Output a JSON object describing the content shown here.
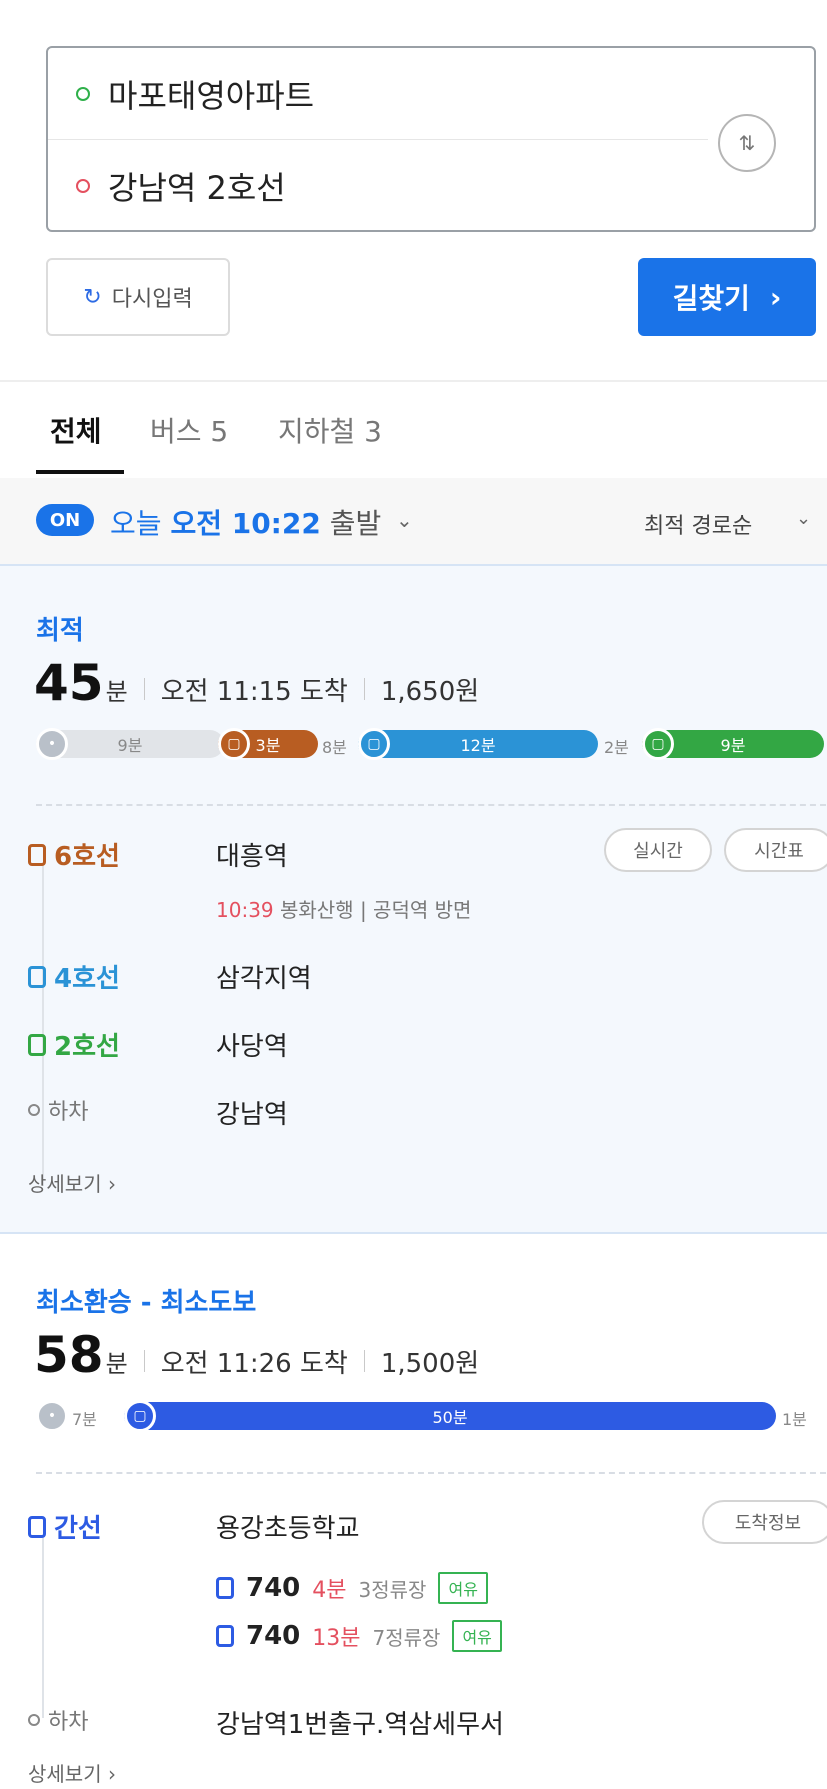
{
  "search": {
    "origin": "마포태영아파트",
    "destination": "강남역 2호선",
    "reset_label": "다시입력",
    "submit_label": "길찾기",
    "submit_chevron": "›",
    "swap_glyph": "⇅"
  },
  "tabs": [
    {
      "label": "전체",
      "active": true
    },
    {
      "label": "버스 5",
      "active": false
    },
    {
      "label": "지하철 3",
      "active": false
    }
  ],
  "departure": {
    "badge": "ON",
    "day": "오늘",
    "time": "오전 10:22",
    "suffix": "출발",
    "sort_label": "최적 경로순"
  },
  "colors": {
    "accent": "#1a73e8",
    "line6": "#b85d22",
    "line4": "#2b93d6",
    "line2": "#33a744",
    "bus_trunk": "#2d5be3",
    "walk": "#e1e4e8",
    "warn_red": "#e4505f",
    "crowd_green": "#35b352"
  },
  "routes": [
    {
      "tag": "최적",
      "duration_num": "45",
      "duration_unit": "분",
      "arrival": "오전 11:15 도착",
      "fare": "1,650원",
      "timeline": [
        {
          "kind": "walk",
          "label": "9분"
        },
        {
          "kind": "line6",
          "label": "3분"
        },
        {
          "kind": "gap",
          "label": "8분"
        },
        {
          "kind": "line4",
          "label": "12분"
        },
        {
          "kind": "gap",
          "label": "2분"
        },
        {
          "kind": "line2",
          "label": "9분"
        }
      ],
      "steps": [
        {
          "line": "6호선",
          "station": "대흥역",
          "color_key": "line6"
        },
        {
          "line": "4호선",
          "station": "삼각지역",
          "color_key": "line4"
        },
        {
          "line": "2호선",
          "station": "사당역",
          "color_key": "line2"
        },
        {
          "line": "하차",
          "station": "강남역",
          "color_key": "none"
        }
      ],
      "first_step_info": {
        "time": "10:39",
        "text": "봉화산행 | 공덕역 방면"
      },
      "pills": [
        "실시간",
        "시간표"
      ],
      "detail": "상세보기 ›"
    },
    {
      "tag": "최소환승 - 최소도보",
      "duration_num": "58",
      "duration_unit": "분",
      "arrival": "오전 11:26 도착",
      "fare": "1,500원",
      "timeline": [
        {
          "kind": "walk",
          "label": "7분"
        },
        {
          "kind": "bus_trunk",
          "label": "50분"
        },
        {
          "kind": "gap",
          "label": "1분"
        }
      ],
      "steps": [
        {
          "line": "간선",
          "station": "용강초등학교",
          "color_key": "bus_trunk"
        },
        {
          "line": "하차",
          "station": "강남역1번출구.역삼세무서",
          "color_key": "none"
        }
      ],
      "buses": [
        {
          "no": "740",
          "min": "4분",
          "stop": "3정류장",
          "crowd": "여유"
        },
        {
          "no": "740",
          "min": "13분",
          "stop": "7정류장",
          "crowd": "여유"
        }
      ],
      "pills": [
        "도착정보"
      ],
      "detail": "상세보기 ›"
    }
  ]
}
